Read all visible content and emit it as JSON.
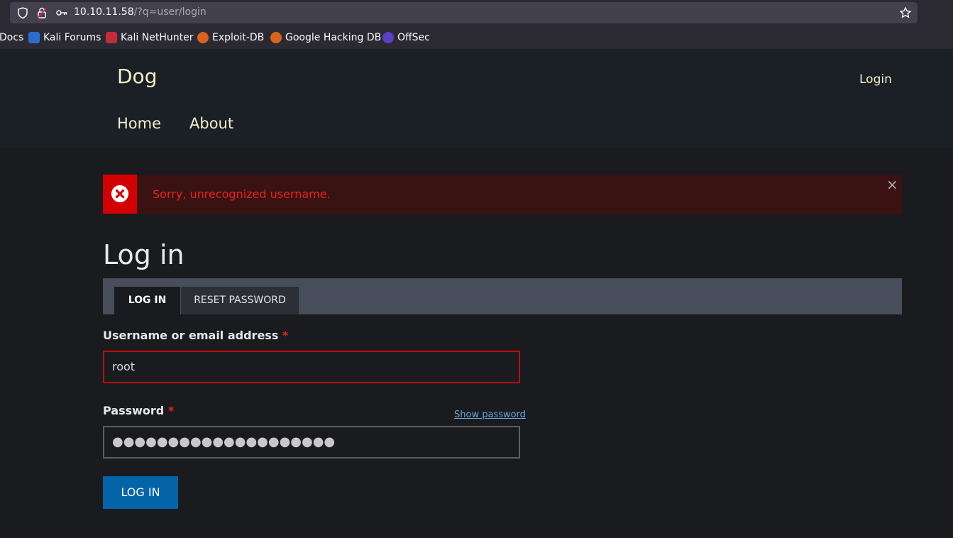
{
  "browser": {
    "url_host": "10.10.11.58",
    "url_path": "/?q=user/login",
    "bookmarks": [
      {
        "label": "Docs",
        "icon": "docs-icon"
      },
      {
        "label": "Kali Forums",
        "icon": "kali-forums-icon"
      },
      {
        "label": "Kali NetHunter",
        "icon": "kali-nethunter-icon"
      },
      {
        "label": "Exploit-DB",
        "icon": "exploit-db-icon"
      },
      {
        "label": "Google Hacking DB",
        "icon": "google-hacking-db-icon"
      },
      {
        "label": "OffSec",
        "icon": "offsec-icon"
      }
    ]
  },
  "header": {
    "site_name": "Dog",
    "login_link": "Login",
    "nav": [
      {
        "label": "Home"
      },
      {
        "label": "About"
      }
    ]
  },
  "message": {
    "text": "Sorry, unrecognized username.",
    "close": "×"
  },
  "page": {
    "title": "Log in",
    "tabs": [
      {
        "label": "LOG IN",
        "active": true
      },
      {
        "label": "RESET PASSWORD",
        "active": false
      }
    ]
  },
  "form": {
    "username_label": "Username or email address",
    "required_mark": "*",
    "username_value": "root",
    "password_label": "Password",
    "show_password": "Show password",
    "password_value": "●●●●●●●●●●●●●●●●●●●●",
    "submit_label": "LOG IN"
  },
  "colors": {
    "accent": "#0563a8",
    "error": "#d20000",
    "header_text": "#f3f0c9"
  }
}
